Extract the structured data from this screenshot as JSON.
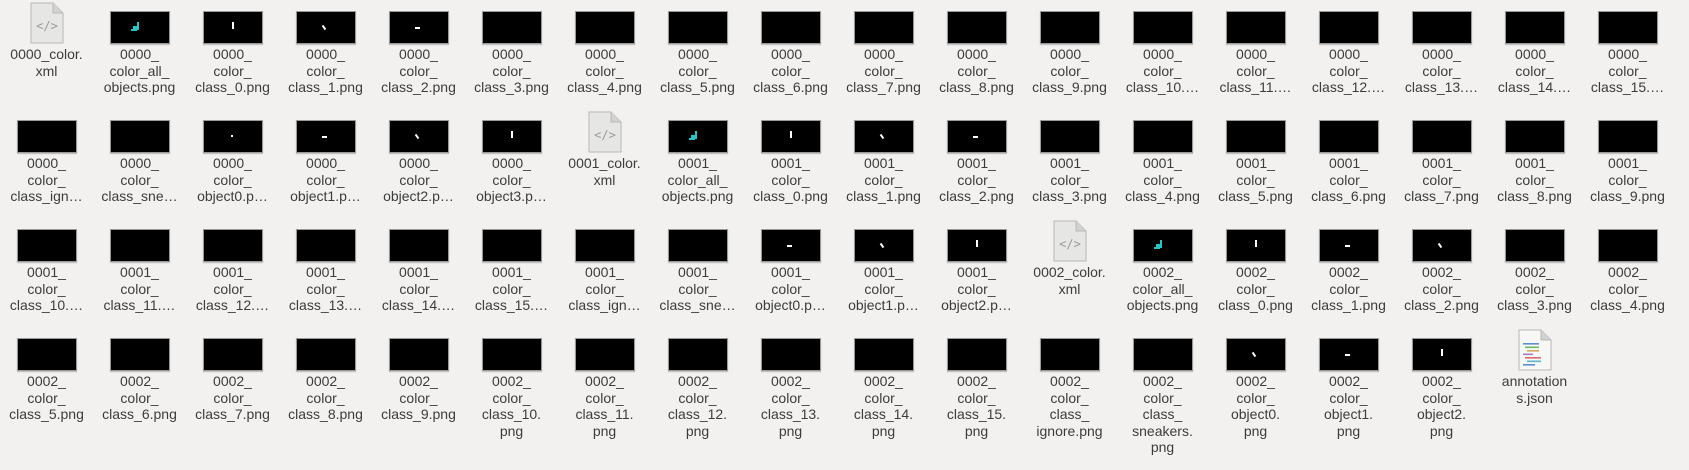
{
  "files": [
    {
      "label": "0000_color.\nxml",
      "icon": "xml-file-icon"
    },
    {
      "label": "0000_\ncolor_all_\nobjects.png",
      "icon": "image-thumbnail",
      "mark": "all"
    },
    {
      "label": "0000_\ncolor_\nclass_0.png",
      "icon": "image-thumbnail",
      "mark": "vbar"
    },
    {
      "label": "0000_\ncolor_\nclass_1.png",
      "icon": "image-thumbnail",
      "mark": "slash"
    },
    {
      "label": "0000_\ncolor_\nclass_2.png",
      "icon": "image-thumbnail",
      "mark": "hdash"
    },
    {
      "label": "0000_\ncolor_\nclass_3.png",
      "icon": "image-thumbnail"
    },
    {
      "label": "0000_\ncolor_\nclass_4.png",
      "icon": "image-thumbnail"
    },
    {
      "label": "0000_\ncolor_\nclass_5.png",
      "icon": "image-thumbnail"
    },
    {
      "label": "0000_\ncolor_\nclass_6.png",
      "icon": "image-thumbnail"
    },
    {
      "label": "0000_\ncolor_\nclass_7.png",
      "icon": "image-thumbnail"
    },
    {
      "label": "0000_\ncolor_\nclass_8.png",
      "icon": "image-thumbnail"
    },
    {
      "label": "0000_\ncolor_\nclass_9.png",
      "icon": "image-thumbnail"
    },
    {
      "label": "0000_\ncolor_\nclass_10.…",
      "icon": "image-thumbnail"
    },
    {
      "label": "0000_\ncolor_\nclass_11.…",
      "icon": "image-thumbnail"
    },
    {
      "label": "0000_\ncolor_\nclass_12.…",
      "icon": "image-thumbnail"
    },
    {
      "label": "0000_\ncolor_\nclass_13.…",
      "icon": "image-thumbnail"
    },
    {
      "label": "0000_\ncolor_\nclass_14.…",
      "icon": "image-thumbnail"
    },
    {
      "label": "0000_\ncolor_\nclass_15.…",
      "icon": "image-thumbnail"
    },
    {
      "label": "0000_\ncolor_\nclass_ign…",
      "icon": "image-thumbnail"
    },
    {
      "label": "0000_\ncolor_\nclass_sne…",
      "icon": "image-thumbnail"
    },
    {
      "label": "0000_\ncolor_\nobject0.p…",
      "icon": "image-thumbnail",
      "mark": "dot"
    },
    {
      "label": "0000_\ncolor_\nobject1.p…",
      "icon": "image-thumbnail",
      "mark": "hdash"
    },
    {
      "label": "0000_\ncolor_\nobject2.p…",
      "icon": "image-thumbnail",
      "mark": "slash"
    },
    {
      "label": "0000_\ncolor_\nobject3.p…",
      "icon": "image-thumbnail",
      "mark": "vbar"
    },
    {
      "label": "0001_color.\nxml",
      "icon": "xml-file-icon"
    },
    {
      "label": "0001_\ncolor_all_\nobjects.png",
      "icon": "image-thumbnail",
      "mark": "all"
    },
    {
      "label": "0001_\ncolor_\nclass_0.png",
      "icon": "image-thumbnail",
      "mark": "vbar"
    },
    {
      "label": "0001_\ncolor_\nclass_1.png",
      "icon": "image-thumbnail",
      "mark": "slash"
    },
    {
      "label": "0001_\ncolor_\nclass_2.png",
      "icon": "image-thumbnail",
      "mark": "hdash"
    },
    {
      "label": "0001_\ncolor_\nclass_3.png",
      "icon": "image-thumbnail"
    },
    {
      "label": "0001_\ncolor_\nclass_4.png",
      "icon": "image-thumbnail"
    },
    {
      "label": "0001_\ncolor_\nclass_5.png",
      "icon": "image-thumbnail"
    },
    {
      "label": "0001_\ncolor_\nclass_6.png",
      "icon": "image-thumbnail"
    },
    {
      "label": "0001_\ncolor_\nclass_7.png",
      "icon": "image-thumbnail"
    },
    {
      "label": "0001_\ncolor_\nclass_8.png",
      "icon": "image-thumbnail"
    },
    {
      "label": "0001_\ncolor_\nclass_9.png",
      "icon": "image-thumbnail"
    },
    {
      "label": "0001_\ncolor_\nclass_10.…",
      "icon": "image-thumbnail"
    },
    {
      "label": "0001_\ncolor_\nclass_11.…",
      "icon": "image-thumbnail"
    },
    {
      "label": "0001_\ncolor_\nclass_12.…",
      "icon": "image-thumbnail"
    },
    {
      "label": "0001_\ncolor_\nclass_13.…",
      "icon": "image-thumbnail"
    },
    {
      "label": "0001_\ncolor_\nclass_14.…",
      "icon": "image-thumbnail"
    },
    {
      "label": "0001_\ncolor_\nclass_15.…",
      "icon": "image-thumbnail"
    },
    {
      "label": "0001_\ncolor_\nclass_ign…",
      "icon": "image-thumbnail"
    },
    {
      "label": "0001_\ncolor_\nclass_sne…",
      "icon": "image-thumbnail"
    },
    {
      "label": "0001_\ncolor_\nobject0.p…",
      "icon": "image-thumbnail",
      "mark": "hdash"
    },
    {
      "label": "0001_\ncolor_\nobject1.p…",
      "icon": "image-thumbnail",
      "mark": "slash"
    },
    {
      "label": "0001_\ncolor_\nobject2.p…",
      "icon": "image-thumbnail",
      "mark": "vbar"
    },
    {
      "label": "0002_color.\nxml",
      "icon": "xml-file-icon"
    },
    {
      "label": "0002_\ncolor_all_\nobjects.png",
      "icon": "image-thumbnail",
      "mark": "all"
    },
    {
      "label": "0002_\ncolor_\nclass_0.png",
      "icon": "image-thumbnail",
      "mark": "vbar"
    },
    {
      "label": "0002_\ncolor_\nclass_1.png",
      "icon": "image-thumbnail",
      "mark": "hdash"
    },
    {
      "label": "0002_\ncolor_\nclass_2.png",
      "icon": "image-thumbnail",
      "mark": "slash"
    },
    {
      "label": "0002_\ncolor_\nclass_3.png",
      "icon": "image-thumbnail"
    },
    {
      "label": "0002_\ncolor_\nclass_4.png",
      "icon": "image-thumbnail"
    },
    {
      "label": "0002_\ncolor_\nclass_5.png",
      "icon": "image-thumbnail"
    },
    {
      "label": "0002_\ncolor_\nclass_6.png",
      "icon": "image-thumbnail"
    },
    {
      "label": "0002_\ncolor_\nclass_7.png",
      "icon": "image-thumbnail"
    },
    {
      "label": "0002_\ncolor_\nclass_8.png",
      "icon": "image-thumbnail"
    },
    {
      "label": "0002_\ncolor_\nclass_9.png",
      "icon": "image-thumbnail"
    },
    {
      "label": "0002_\ncolor_\nclass_10.\npng",
      "icon": "image-thumbnail"
    },
    {
      "label": "0002_\ncolor_\nclass_11.\npng",
      "icon": "image-thumbnail"
    },
    {
      "label": "0002_\ncolor_\nclass_12.\npng",
      "icon": "image-thumbnail"
    },
    {
      "label": "0002_\ncolor_\nclass_13.\npng",
      "icon": "image-thumbnail"
    },
    {
      "label": "0002_\ncolor_\nclass_14.\npng",
      "icon": "image-thumbnail"
    },
    {
      "label": "0002_\ncolor_\nclass_15.\npng",
      "icon": "image-thumbnail"
    },
    {
      "label": "0002_\ncolor_\nclass_\nignore.png",
      "icon": "image-thumbnail"
    },
    {
      "label": "0002_\ncolor_\nclass_\nsneakers.\npng",
      "icon": "image-thumbnail"
    },
    {
      "label": "0002_\ncolor_\nobject0.\npng",
      "icon": "image-thumbnail",
      "mark": "slash"
    },
    {
      "label": "0002_\ncolor_\nobject1.\npng",
      "icon": "image-thumbnail",
      "mark": "hdash"
    },
    {
      "label": "0002_\ncolor_\nobject2.\npng",
      "icon": "image-thumbnail",
      "mark": "vbar"
    },
    {
      "label": "annotation\ns.json",
      "icon": "json-file-icon"
    }
  ],
  "colors": {
    "background": "#f2f1f0",
    "text": "#3c3c3c",
    "mask_object": "#ffffff",
    "mask_all_objects": "#27c5c5"
  }
}
